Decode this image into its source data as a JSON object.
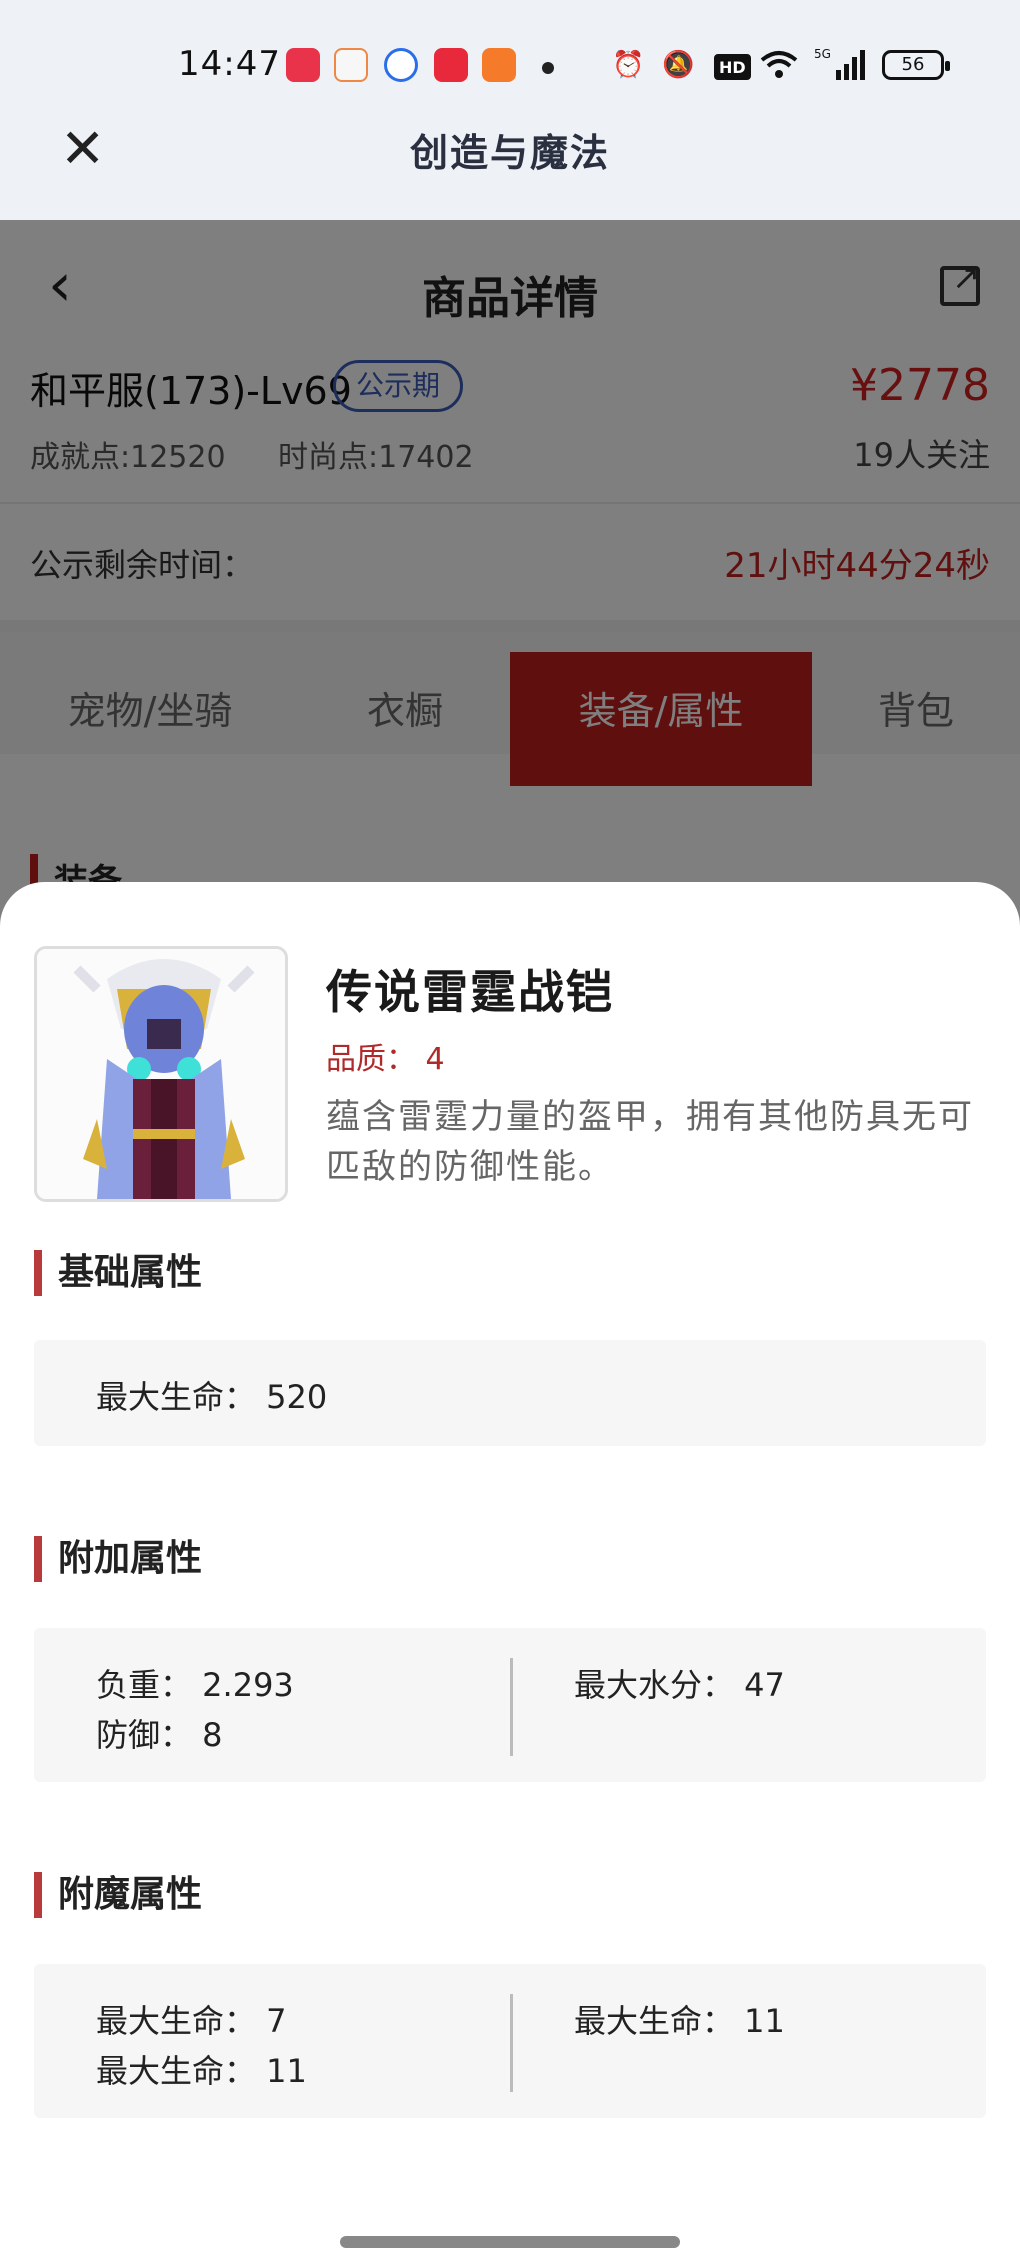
{
  "status_bar": {
    "time": "14:47",
    "battery": "56",
    "network": "5G",
    "hd_label": "HD"
  },
  "app_bar": {
    "title": "创造与魔法"
  },
  "page": {
    "nav_title": "商品详情",
    "product_name": "和平服(173)-Lv69",
    "badge": "公示期",
    "price": "¥2778",
    "achievement": "成就点:12520",
    "fashion": "时尚点:17402",
    "followers": "19人关注",
    "remaining_label": "公示剩余时间：",
    "remaining_value": "21小时44分24秒",
    "tabs": [
      {
        "label": "宠物/坐骑"
      },
      {
        "label": "衣橱"
      },
      {
        "label": "装备/属性"
      },
      {
        "label": "背包"
      }
    ],
    "section_peek": "装备"
  },
  "sheet": {
    "item_name": "传说雷霆战铠",
    "quality": "品质： 4",
    "description": "蕴含雷霆力量的盔甲，拥有其他防具无可匹敌的防御性能。",
    "basic": {
      "title": "基础属性",
      "attrs": [
        "最大生命： 520"
      ]
    },
    "extra": {
      "title": "附加属性",
      "left": [
        "负重： 2.293",
        "防御： 8"
      ],
      "right": [
        "最大水分： 47"
      ]
    },
    "enchant": {
      "title": "附魔属性",
      "left": [
        "最大生命： 7",
        "最大生命： 11"
      ],
      "right": [
        "最大生命： 11"
      ]
    }
  },
  "colors": {
    "accent_red": "#c01e1e",
    "badge_blue": "#3a5db8"
  }
}
